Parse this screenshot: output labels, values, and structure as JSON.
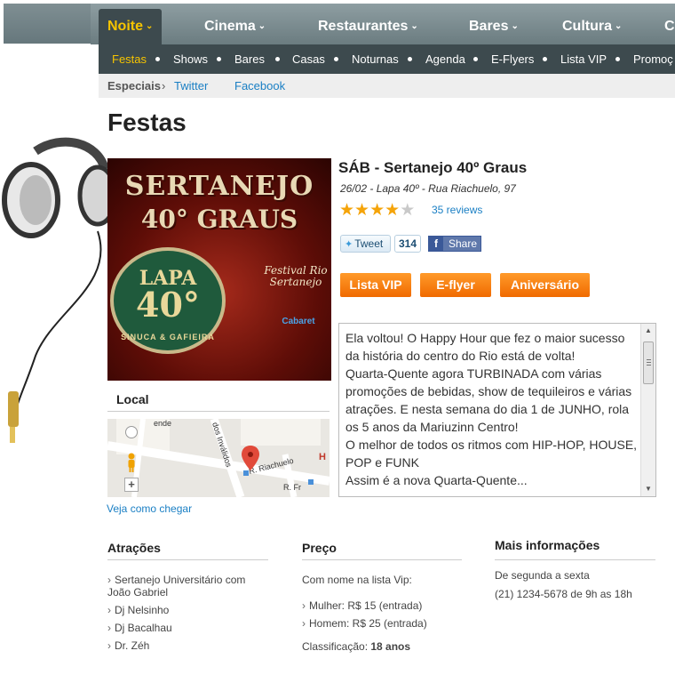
{
  "nav": {
    "items": [
      {
        "label": "Noite",
        "active": true
      },
      {
        "label": "Cinema"
      },
      {
        "label": "Restaurantes"
      },
      {
        "label": "Bares"
      },
      {
        "label": "Cultura"
      },
      {
        "label": "C"
      }
    ]
  },
  "subnav": {
    "items": [
      "Festas",
      "Shows",
      "Bares",
      "Casas",
      "Noturnas",
      "Agenda",
      "E-Flyers",
      "Lista VIP",
      "Promoç"
    ]
  },
  "breadcrumb": {
    "label": "Especiais",
    "separator": "›",
    "links": [
      "Twitter",
      "Facebook"
    ]
  },
  "page": {
    "title": "Festas"
  },
  "flyer": {
    "line1": "SERTANEJO",
    "line2": "40° GRAUS",
    "lapa": "LAPA",
    "forty": "40°",
    "sinuca": "SINUCA & GAFIEIRA",
    "festival": "Festival Rio Sertanejo",
    "sponsor": "Cabaret"
  },
  "event": {
    "title": "SÁB -  Sertanejo 40º Graus",
    "subtitle": "26/02 - Lapa 40º - Rua Riachuelo, 97",
    "rating": 4,
    "rating_max": 5,
    "reviews_label": "35 reviews",
    "tweet_label": "Tweet",
    "tweet_count": "314",
    "share_label": "Share",
    "buttons": [
      "Lista VIP",
      "E-flyer",
      "Aniversário"
    ],
    "description": [
      "Ela voltou! O Happy Hour que fez o maior sucesso da história do centro do Rio está de volta!",
      "Quarta-Quente agora TURBINADA com várias promoções de bebidas, show de tequileiros e várias atrações. E nesta semana do dia 1 de JUNHO, rola os 5 anos da Mariuzinn Centro!",
      "O melhor de todos os ritmos com HIP-HOP, HOUSE, POP e FUNK",
      "Assim é a nova Quarta-Quente..."
    ]
  },
  "local": {
    "heading": "Local",
    "map_labels": {
      "street1": "R. Riachuelo",
      "street2": "dos Inválidos",
      "street3": "ende",
      "street4": "R. Fr",
      "h": "H"
    },
    "directions": "Veja como chegar"
  },
  "attractions": {
    "heading": "Atrações",
    "items": [
      "Sertanejo Universitário com João Gabriel",
      "Dj Nelsinho",
      "Dj Bacalhau",
      "Dr. Zéh"
    ]
  },
  "price": {
    "heading": "Preço",
    "intro": "Com nome na lista Vip:",
    "items": [
      "Mulher: R$ 15 (entrada)",
      "Homem: R$ 25 (entrada)"
    ],
    "class_label": "Classificação:",
    "class_value": "18 anos"
  },
  "info": {
    "heading": "Mais informações",
    "line1": "De segunda a sexta",
    "line2": "(21) 1234-5678 de 9h as 18h"
  },
  "colors": {
    "accent_orange": "#f06a00",
    "nav_dark": "#3d4a4e",
    "active_yellow": "#f6c400",
    "link_blue": "#1a7fc4"
  }
}
